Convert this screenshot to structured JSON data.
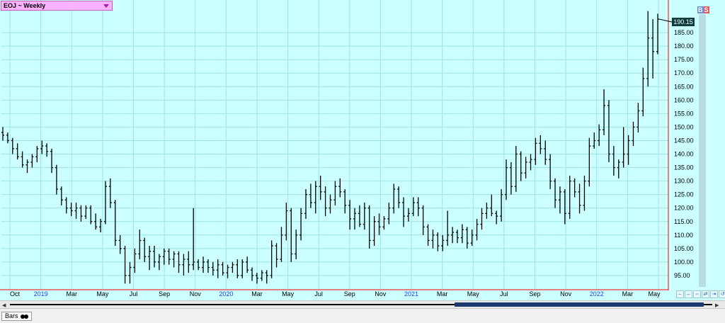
{
  "window": {
    "title": "EOJ ~ Weekly",
    "status_tab": "Bars",
    "last_price": "190.15",
    "badge_b": "B",
    "badge_s": "S"
  },
  "colors": {
    "background": "#ccffff",
    "grid": "#9ee3e3",
    "bars": "#000000",
    "axis_line": "#ff0000",
    "x_label_default": "#000000",
    "x_label_year": "#2040ff"
  },
  "chart_data": {
    "type": "bar",
    "style": "ohlc",
    "title": "EOJ ~ Weekly",
    "xlabel": "",
    "ylabel": "",
    "ylim": [
      90,
      195
    ],
    "y_ticks": [
      "95.00",
      "100.00",
      "105.00",
      "110.00",
      "115.00",
      "120.00",
      "125.00",
      "130.00",
      "135.00",
      "140.00",
      "145.00",
      "150.00",
      "155.00",
      "160.00",
      "165.00",
      "170.00",
      "175.00",
      "180.00",
      "185.00",
      "190.15"
    ],
    "x_labels": [
      {
        "label": "Oct",
        "year": false
      },
      {
        "label": "2019",
        "year": true
      },
      {
        "label": "Mar",
        "year": false
      },
      {
        "label": "May",
        "year": false
      },
      {
        "label": "Jul",
        "year": false
      },
      {
        "label": "Sep",
        "year": false
      },
      {
        "label": "Nov",
        "year": false
      },
      {
        "label": "2020",
        "year": true
      },
      {
        "label": "Mar",
        "year": false
      },
      {
        "label": "May",
        "year": false
      },
      {
        "label": "Jul",
        "year": false
      },
      {
        "label": "Sep",
        "year": false
      },
      {
        "label": "Nov",
        "year": false
      },
      {
        "label": "2021",
        "year": true
      },
      {
        "label": "Mar",
        "year": false
      },
      {
        "label": "May",
        "year": false
      },
      {
        "label": "Jul",
        "year": false
      },
      {
        "label": "Sep",
        "year": false
      },
      {
        "label": "Nov",
        "year": false
      },
      {
        "label": "2022",
        "year": true
      },
      {
        "label": "Mar",
        "year": false
      },
      {
        "label": "May",
        "year": false
      }
    ],
    "grid": true,
    "legend": "none",
    "series": [
      {
        "values": [
          [
            148,
            150,
            145,
            147
          ],
          [
            147,
            148,
            144,
            145
          ],
          [
            145,
            146,
            140,
            142
          ],
          [
            142,
            144,
            138,
            139
          ],
          [
            139,
            141,
            135,
            136
          ],
          [
            136,
            138,
            133,
            137
          ],
          [
            137,
            140,
            135,
            139
          ],
          [
            139,
            143,
            137,
            142
          ],
          [
            142,
            145,
            140,
            143
          ],
          [
            143,
            144,
            139,
            141
          ],
          [
            141,
            142,
            133,
            135
          ],
          [
            135,
            136,
            125,
            127
          ],
          [
            127,
            128,
            121,
            123
          ],
          [
            123,
            124,
            118,
            120
          ],
          [
            120,
            122,
            117,
            119
          ],
          [
            119,
            122,
            116,
            120
          ],
          [
            120,
            121,
            115,
            117
          ],
          [
            117,
            121,
            116,
            120
          ],
          [
            120,
            121,
            114,
            115
          ],
          [
            115,
            118,
            112,
            113
          ],
          [
            113,
            116,
            111,
            115
          ],
          [
            115,
            130,
            114,
            128
          ],
          [
            128,
            131,
            120,
            122
          ],
          [
            122,
            123,
            106,
            108
          ],
          [
            108,
            110,
            103,
            105
          ],
          [
            105,
            106,
            92,
            95
          ],
          [
            95,
            100,
            92,
            98
          ],
          [
            98,
            105,
            96,
            103
          ],
          [
            103,
            112,
            101,
            108
          ],
          [
            108,
            109,
            100,
            102
          ],
          [
            102,
            106,
            97,
            104
          ],
          [
            104,
            106,
            98,
            100
          ],
          [
            100,
            103,
            97,
            102
          ],
          [
            102,
            105,
            99,
            104
          ],
          [
            104,
            105,
            99,
            101
          ],
          [
            101,
            104,
            98,
            103
          ],
          [
            103,
            104,
            96,
            99
          ],
          [
            99,
            103,
            95,
            101
          ],
          [
            101,
            104,
            96,
            99
          ],
          [
            99,
            120,
            97,
            100
          ],
          [
            100,
            101,
            97,
            98
          ],
          [
            98,
            102,
            96,
            100
          ],
          [
            100,
            101,
            96,
            98
          ],
          [
            98,
            100,
            95,
            97
          ],
          [
            97,
            101,
            94,
            99
          ],
          [
            99,
            100,
            95,
            96
          ],
          [
            96,
            99,
            94,
            98
          ],
          [
            98,
            100,
            96,
            99
          ],
          [
            99,
            101,
            94,
            95
          ],
          [
            95,
            101,
            94,
            100
          ],
          [
            100,
            102,
            96,
            97
          ],
          [
            97,
            98,
            93,
            95
          ],
          [
            95,
            96,
            92,
            94
          ],
          [
            94,
            97,
            93,
            96
          ],
          [
            96,
            97,
            92,
            95
          ],
          [
            95,
            108,
            94,
            106
          ],
          [
            106,
            107,
            98,
            101
          ],
          [
            101,
            113,
            100,
            110
          ],
          [
            110,
            122,
            108,
            119
          ],
          [
            119,
            120,
            100,
            103
          ],
          [
            103,
            112,
            101,
            110
          ],
          [
            110,
            120,
            108,
            118
          ],
          [
            118,
            127,
            116,
            125
          ],
          [
            125,
            129,
            120,
            122
          ],
          [
            122,
            130,
            118,
            128
          ],
          [
            128,
            132,
            123,
            126
          ],
          [
            126,
            128,
            117,
            120
          ],
          [
            120,
            125,
            118,
            123
          ],
          [
            123,
            130,
            121,
            128
          ],
          [
            128,
            131,
            124,
            126
          ],
          [
            126,
            127,
            118,
            121
          ],
          [
            121,
            123,
            112,
            116
          ],
          [
            116,
            120,
            112,
            118
          ],
          [
            118,
            121,
            113,
            114
          ],
          [
            114,
            122,
            112,
            120
          ],
          [
            120,
            121,
            105,
            108
          ],
          [
            108,
            117,
            106,
            115
          ],
          [
            115,
            118,
            110,
            113
          ],
          [
            113,
            117,
            112,
            116
          ],
          [
            116,
            122,
            114,
            120
          ],
          [
            120,
            129,
            118,
            127
          ],
          [
            127,
            128,
            120,
            122
          ],
          [
            122,
            124,
            113,
            117
          ],
          [
            117,
            120,
            115,
            118
          ],
          [
            118,
            124,
            117,
            122
          ],
          [
            122,
            124,
            117,
            120
          ],
          [
            120,
            121,
            110,
            113
          ],
          [
            113,
            114,
            106,
            108
          ],
          [
            108,
            112,
            105,
            110
          ],
          [
            110,
            111,
            104,
            106
          ],
          [
            106,
            110,
            104,
            108
          ],
          [
            108,
            119,
            106,
            110
          ],
          [
            110,
            113,
            107,
            111
          ],
          [
            111,
            112,
            107,
            109
          ],
          [
            109,
            114,
            107,
            112
          ],
          [
            112,
            113,
            105,
            107
          ],
          [
            107,
            112,
            106,
            110
          ],
          [
            110,
            116,
            108,
            114
          ],
          [
            114,
            120,
            112,
            118
          ],
          [
            118,
            122,
            116,
            120
          ],
          [
            120,
            125,
            117,
            118
          ],
          [
            118,
            119,
            114,
            117
          ],
          [
            117,
            127,
            115,
            125
          ],
          [
            125,
            138,
            123,
            135
          ],
          [
            135,
            137,
            125,
            128
          ],
          [
            128,
            143,
            126,
            140
          ],
          [
            140,
            141,
            130,
            133
          ],
          [
            133,
            139,
            131,
            137
          ],
          [
            137,
            140,
            134,
            138
          ],
          [
            138,
            146,
            136,
            144
          ],
          [
            144,
            147,
            140,
            142
          ],
          [
            142,
            145,
            136,
            138
          ],
          [
            138,
            140,
            127,
            130
          ],
          [
            130,
            131,
            120,
            123
          ],
          [
            123,
            128,
            118,
            126
          ],
          [
            126,
            127,
            114,
            118
          ],
          [
            118,
            132,
            116,
            130
          ],
          [
            130,
            131,
            124,
            126
          ],
          [
            126,
            129,
            118,
            121
          ],
          [
            121,
            132,
            119,
            130
          ],
          [
            130,
            146,
            128,
            143
          ],
          [
            143,
            148,
            142,
            145
          ],
          [
            145,
            151,
            143,
            149
          ],
          [
            149,
            164,
            147,
            158
          ],
          [
            158,
            160,
            137,
            140
          ],
          [
            140,
            143,
            132,
            135
          ],
          [
            135,
            138,
            131,
            137
          ],
          [
            137,
            150,
            135,
            140
          ],
          [
            140,
            147,
            136,
            145
          ],
          [
            145,
            152,
            143,
            150
          ],
          [
            150,
            159,
            148,
            156
          ],
          [
            156,
            172,
            154,
            168
          ],
          [
            168,
            193,
            165,
            183
          ],
          [
            183,
            190,
            168,
            178
          ],
          [
            178,
            192,
            177,
            190
          ]
        ]
      }
    ]
  }
}
